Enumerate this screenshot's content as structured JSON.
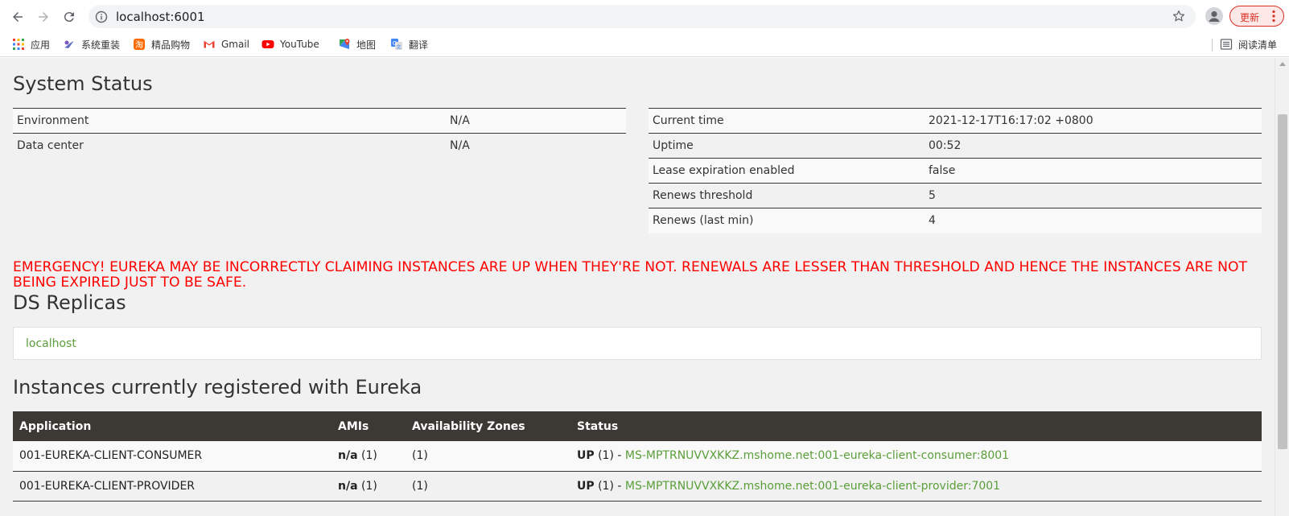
{
  "browser": {
    "url": "localhost:6001",
    "update_label": "更新",
    "bookmarks": [
      {
        "label": "应用",
        "icon": "apps-grid-icon"
      },
      {
        "label": "系统重装",
        "icon": "system-reinstall-icon"
      },
      {
        "label": "精品购物",
        "icon": "taobao-icon"
      },
      {
        "label": "Gmail",
        "icon": "gmail-icon"
      },
      {
        "label": "YouTube",
        "icon": "youtube-icon"
      },
      {
        "label": "地图",
        "icon": "maps-icon"
      },
      {
        "label": "翻译",
        "icon": "translate-icon"
      }
    ],
    "reading_list_label": "阅读清单"
  },
  "system_status": {
    "title": "System Status",
    "left": [
      {
        "key": "Environment",
        "value": "N/A"
      },
      {
        "key": "Data center",
        "value": "N/A"
      }
    ],
    "right": [
      {
        "key": "Current time",
        "value": "2021-12-17T16:17:02 +0800"
      },
      {
        "key": "Uptime",
        "value": "00:52"
      },
      {
        "key": "Lease expiration enabled",
        "value": "false"
      },
      {
        "key": "Renews threshold",
        "value": "5"
      },
      {
        "key": "Renews (last min)",
        "value": "4"
      }
    ]
  },
  "emergency": "EMERGENCY! EUREKA MAY BE INCORRECTLY CLAIMING INSTANCES ARE UP WHEN THEY'RE NOT. RENEWALS ARE LESSER THAN THRESHOLD AND HENCE THE INSTANCES ARE NOT BEING EXPIRED JUST TO BE SAFE.",
  "replicas": {
    "title": "DS Replicas",
    "items": [
      "localhost"
    ]
  },
  "instances": {
    "title": "Instances currently registered with Eureka",
    "columns": [
      "Application",
      "AMIs",
      "Availability Zones",
      "Status"
    ],
    "rows": [
      {
        "application": "001-EUREKA-CLIENT-CONSUMER",
        "amis_bold": "n/a",
        "amis_count": "(1)",
        "zones": "(1)",
        "status_bold": "UP",
        "status_count": "(1) -",
        "instance_link": "MS-MPTRNUVVXKKZ.mshome.net:001-eureka-client-consumer:8001"
      },
      {
        "application": "001-EUREKA-CLIENT-PROVIDER",
        "amis_bold": "n/a",
        "amis_count": "(1)",
        "zones": "(1)",
        "status_bold": "UP",
        "status_count": "(1) -",
        "instance_link": "MS-MPTRNUVVXKKZ.mshome.net:001-eureka-client-provider:7001"
      }
    ]
  },
  "colors": {
    "header_bg": "#3c3833",
    "link": "#5a9e3a",
    "emergency": "#ff0000",
    "page_bg": "#f1f1f1"
  }
}
